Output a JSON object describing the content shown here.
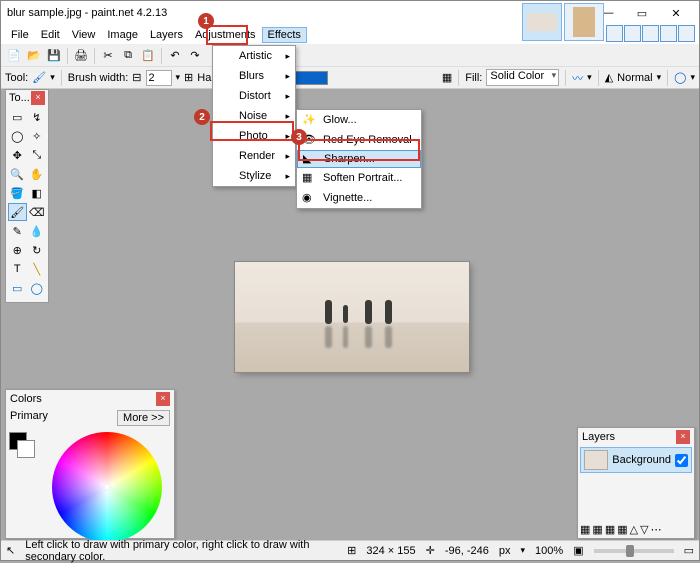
{
  "title": "blur sample.jpg - paint.net 4.2.13",
  "menu": {
    "file": "File",
    "edit": "Edit",
    "view": "View",
    "image": "Image",
    "layers": "Layers",
    "adjustments": "Adjustments",
    "effects": "Effects"
  },
  "toolrow": {
    "tool_label": "Tool:",
    "brush_label": "Brush width:",
    "brush_val": "2",
    "hard": "Hardness",
    "fill_label": "Fill:",
    "fill_val": "Solid Color",
    "normal": "Normal"
  },
  "effects_menu": [
    "Artistic",
    "Blurs",
    "Distort",
    "Noise",
    "Photo",
    "Render",
    "Stylize"
  ],
  "photo_menu": [
    "Glow...",
    "Red Eye Removal",
    "Sharpen...",
    "Soften Portrait...",
    "Vignette..."
  ],
  "markers": {
    "m1": "1",
    "m2": "2",
    "m3": "3"
  },
  "tools_pal": {
    "title": "To..."
  },
  "colors": {
    "title": "Colors",
    "primary": "Primary",
    "more": "More >>"
  },
  "layers": {
    "title": "Layers",
    "bg": "Background"
  },
  "status": {
    "hint": "Left click to draw with primary color, right click to draw with secondary color.",
    "size": "324 × 155",
    "cursor": "-96, -246",
    "px": "px",
    "zoom": "100%"
  }
}
